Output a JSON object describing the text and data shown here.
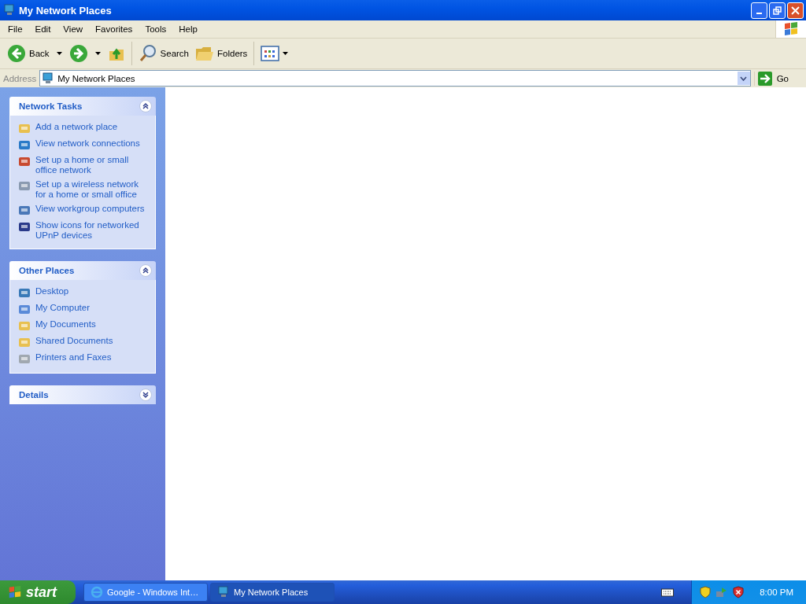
{
  "window": {
    "title": "My Network Places"
  },
  "menu": [
    "File",
    "Edit",
    "View",
    "Favorites",
    "Tools",
    "Help"
  ],
  "toolbar": {
    "back": "Back",
    "search": "Search",
    "folders": "Folders"
  },
  "address": {
    "label": "Address",
    "value": "My Network Places",
    "go": "Go"
  },
  "panels": [
    {
      "title": "Network Tasks",
      "expanded": true,
      "items": [
        "Add a network place",
        "View network connections",
        "Set up a home or small office network",
        "Set up a wireless network for a home or small office",
        "View workgroup computers",
        "Show icons for networked UPnP devices"
      ]
    },
    {
      "title": "Other Places",
      "expanded": true,
      "items": [
        "Desktop",
        "My Computer",
        "My Documents",
        "Shared Documents",
        "Printers and Faxes"
      ]
    },
    {
      "title": "Details",
      "expanded": false
    }
  ],
  "taskbar": {
    "start": "start",
    "tasks": [
      {
        "label": "Google - Windows Int…",
        "selected": false
      },
      {
        "label": "My Network Places",
        "selected": true
      }
    ],
    "clock": "8:00 PM"
  }
}
